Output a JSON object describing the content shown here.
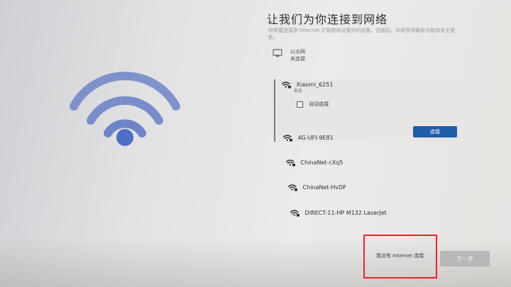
{
  "page": {
    "title": "让我们为你连接到网络",
    "description": "你需要连接到 Internet 才能继续设置你的设备。连接后，你将获得最新功能和安全更新。"
  },
  "ethernet": {
    "label": "以太网",
    "status": "未连接",
    "icon": "ethernet-icon"
  },
  "selected_network": {
    "name": "Xiaomi_6251",
    "security": "安全",
    "auto_connect_label": "自动连接",
    "auto_connect_checked": false,
    "connect_label": "连接",
    "icon": "wifi-secured-icon"
  },
  "networks": [
    {
      "name": "4G-UFI-9E81",
      "icon": "wifi-secured-icon"
    },
    {
      "name": "ChinaNet-cXq5",
      "icon": "wifi-secured-icon"
    },
    {
      "name": "ChinaNet-HvDF",
      "icon": "wifi-secured-icon"
    },
    {
      "name": "DIRECT-11-HP M132 LaserJet",
      "icon": "wifi-secured-icon"
    }
  ],
  "footer": {
    "no_internet_label": "我没有 Internet 连接",
    "next_label": "下一步"
  },
  "colors": {
    "accent": "#1f5da9",
    "wifi_illustration": "#4d6fc4",
    "highlight_box": "#e8262b",
    "next_disabled": "#b9b8b6"
  }
}
